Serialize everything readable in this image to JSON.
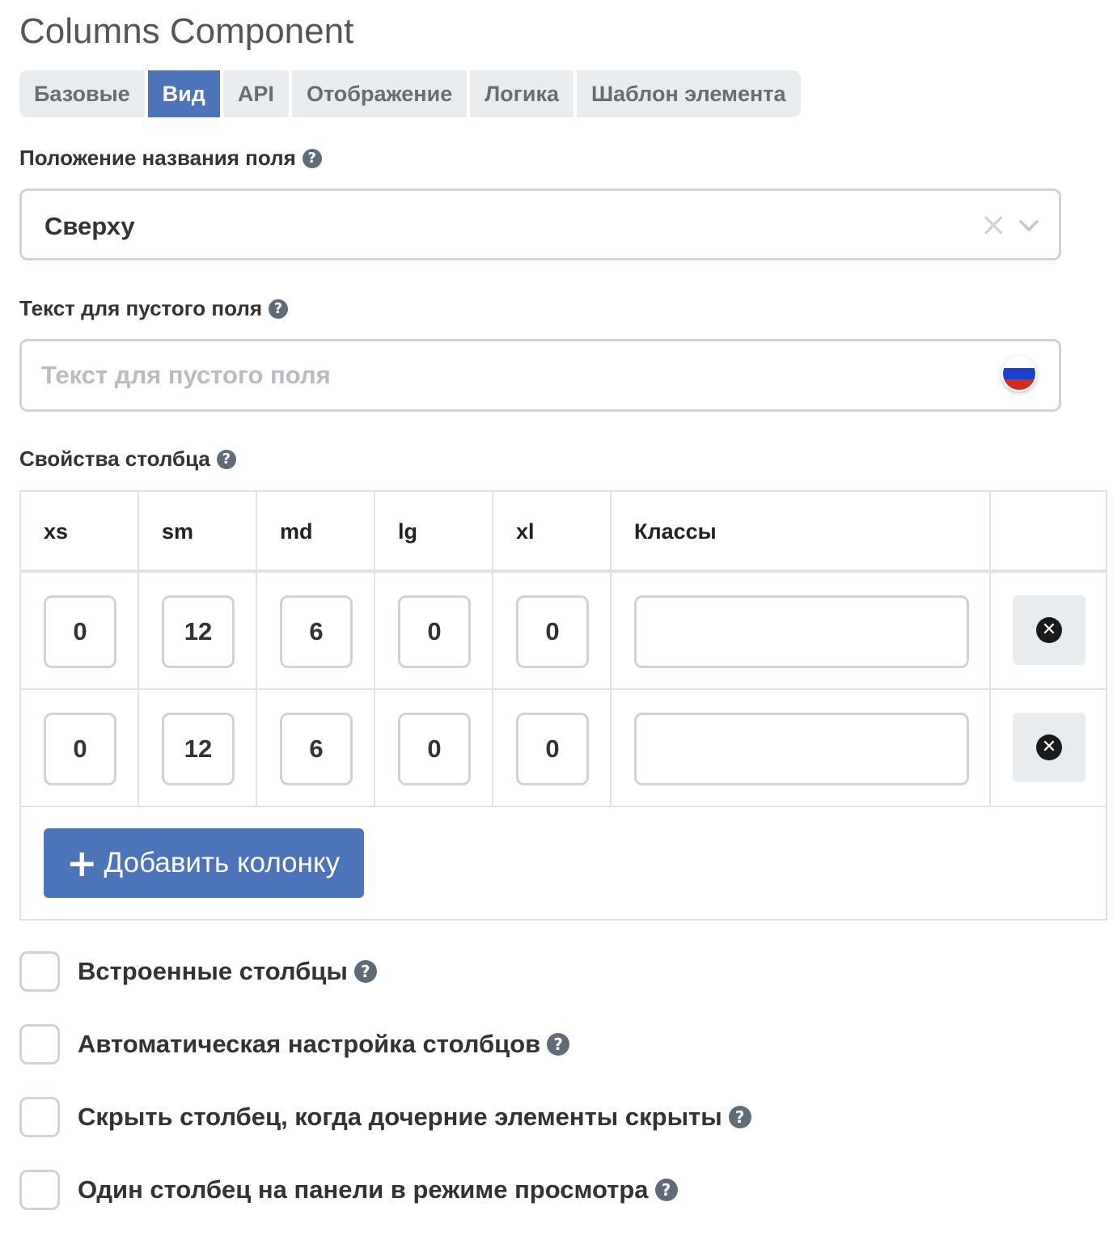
{
  "header": {
    "title": "Columns Component"
  },
  "tabs": [
    {
      "label": "Базовые",
      "active": false
    },
    {
      "label": "Вид",
      "active": true
    },
    {
      "label": "API",
      "active": false
    },
    {
      "label": "Отображение",
      "active": false
    },
    {
      "label": "Логика",
      "active": false
    },
    {
      "label": "Шаблон элемента",
      "active": false
    }
  ],
  "label_position": {
    "label": "Положение названия поля",
    "value": "Сверху",
    "clear_glyph": "×"
  },
  "placeholder_field": {
    "label": "Текст для пустого поля",
    "placeholder": "Текст для пустого поля",
    "value": ""
  },
  "column_props": {
    "label": "Свойства столбца",
    "headers": [
      "xs",
      "sm",
      "md",
      "lg",
      "xl",
      "Классы"
    ],
    "rows": [
      {
        "xs": "0",
        "sm": "12",
        "md": "6",
        "lg": "0",
        "xl": "0",
        "classes": ""
      },
      {
        "xs": "0",
        "sm": "12",
        "md": "6",
        "lg": "0",
        "xl": "0",
        "classes": ""
      }
    ],
    "add_label": "Добавить колонку"
  },
  "checkboxes": [
    {
      "label": "Встроенные столбцы",
      "checked": false
    },
    {
      "label": "Автоматическая настройка столбцов",
      "checked": false
    },
    {
      "label": "Скрыть столбец, когда дочерние элементы скрыты",
      "checked": false
    },
    {
      "label": "Один столбец на панели в режиме просмотра",
      "checked": false
    }
  ],
  "icons": {
    "help": "question-circle-icon",
    "remove": "times-circle-icon",
    "add": "plus-icon",
    "chevron": "chevron-down-icon",
    "clear": "close-icon",
    "language": "russian-flag-icon"
  },
  "colors": {
    "accent": "#4b74b9",
    "tab_bg": "#e9ecef",
    "border": "#cfd2d6",
    "help_icon": "#5f6b76",
    "flag_white": "#ffffff",
    "flag_blue": "#1c3fd0",
    "flag_red": "#d52b1e"
  }
}
